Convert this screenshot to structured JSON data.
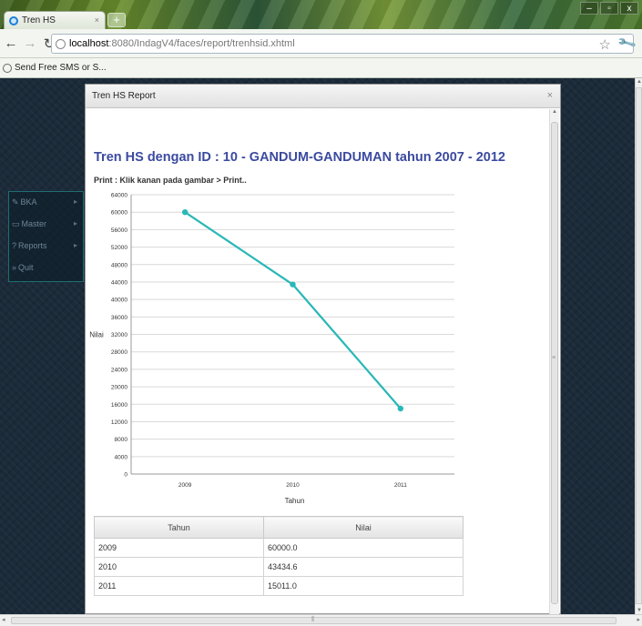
{
  "browser": {
    "tab_title": "Tren HS",
    "tab_close": "×",
    "new_tab": "+",
    "url_host": "localhost",
    "url_path": ":8080/IndagV4/faces/report/trenhsid.xhtml",
    "bookmark": "Send Free SMS or S...",
    "window_buttons": [
      "–",
      "▫",
      "x"
    ]
  },
  "sidebar": {
    "items": [
      {
        "icon": "pencil-icon",
        "label": "BKA"
      },
      {
        "icon": "folder-icon",
        "label": "Master"
      },
      {
        "icon": "report-icon",
        "label": "Reports"
      },
      {
        "icon": "exit-icon",
        "label": "Quit"
      }
    ]
  },
  "dialog": {
    "title": "Tren HS Report",
    "close": "×",
    "report_title": "Tren HS dengan ID : 10 - GANDUM-GANDUMAN tahun 2007 - 2012",
    "print_hint": "Print : Klik kanan pada gambar > Print.."
  },
  "chart_data": {
    "type": "line",
    "categories": [
      "2009",
      "2010",
      "2011"
    ],
    "series": [
      {
        "values": [
          60000.0,
          43434.6,
          15011.0
        ],
        "color": "#2ab7b7"
      }
    ],
    "xlabel": "Tahun",
    "ylabel": "Nilai",
    "ylim": [
      0,
      64000
    ],
    "yticks": [
      0,
      4000,
      8000,
      12000,
      16000,
      20000,
      24000,
      28000,
      32000,
      36000,
      40000,
      44000,
      48000,
      52000,
      56000,
      60000,
      64000
    ],
    "grid": true
  },
  "table": {
    "columns": [
      "Tahun",
      "Nilai"
    ],
    "rows": [
      [
        "2009",
        "60000.0"
      ],
      [
        "2010",
        "43434.6"
      ],
      [
        "2011",
        "15011.0"
      ]
    ]
  },
  "colors": {
    "accent": "#2ab7b7",
    "title": "#3b4aa0",
    "page_bg": "#1c2b3a"
  }
}
